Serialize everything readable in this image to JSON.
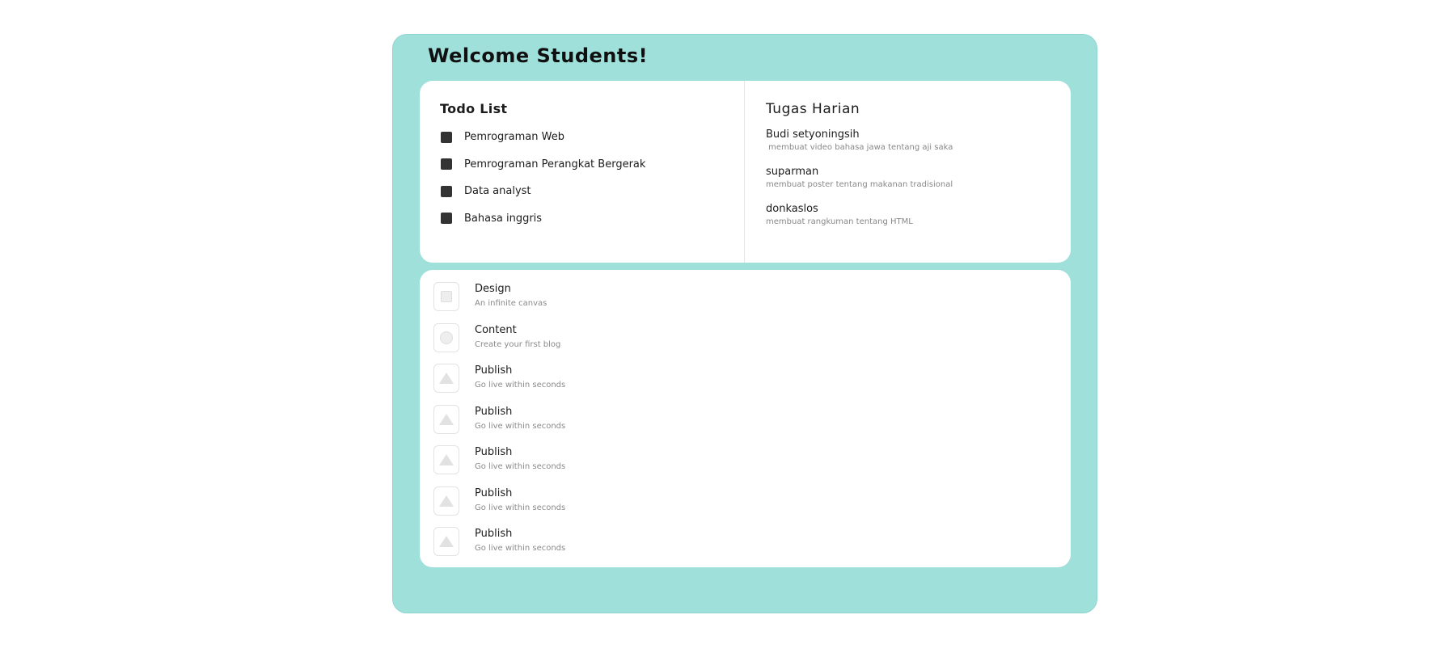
{
  "header": {
    "title": "Welcome Students!"
  },
  "todo": {
    "title": "Todo List",
    "items": [
      {
        "label": "Pemrograman Web"
      },
      {
        "label": "Pemrograman Perangkat Bergerak"
      },
      {
        "label": "Data analyst"
      },
      {
        "label": "Bahasa inggris"
      }
    ]
  },
  "tugas": {
    "title": "Tugas Harian",
    "items": [
      {
        "name": "Budi setyoningsih",
        "desc": " membuat video bahasa jawa tentang aji saka"
      },
      {
        "name": "suparman",
        "desc": "membuat poster tentang makanan tradisional"
      },
      {
        "name": "donkaslos",
        "desc": "membuat rangkuman tentang HTML"
      }
    ]
  },
  "features": {
    "items": [
      {
        "icon": "square-icon",
        "title": "Design",
        "desc": "An infinite canvas"
      },
      {
        "icon": "circle-icon",
        "title": "Content",
        "desc": "Create your first blog"
      },
      {
        "icon": "triangle-icon",
        "title": "Publish",
        "desc": "Go live within seconds"
      },
      {
        "icon": "triangle-icon",
        "title": "Publish",
        "desc": "Go live within seconds"
      },
      {
        "icon": "triangle-icon",
        "title": "Publish",
        "desc": "Go live within seconds"
      },
      {
        "icon": "triangle-icon",
        "title": "Publish",
        "desc": "Go live within seconds"
      },
      {
        "icon": "triangle-icon",
        "title": "Publish",
        "desc": "Go live within seconds"
      }
    ]
  },
  "colors": {
    "frame_background": "#9fe0db",
    "card_background": "#ffffff",
    "checkbox": "#333333"
  }
}
